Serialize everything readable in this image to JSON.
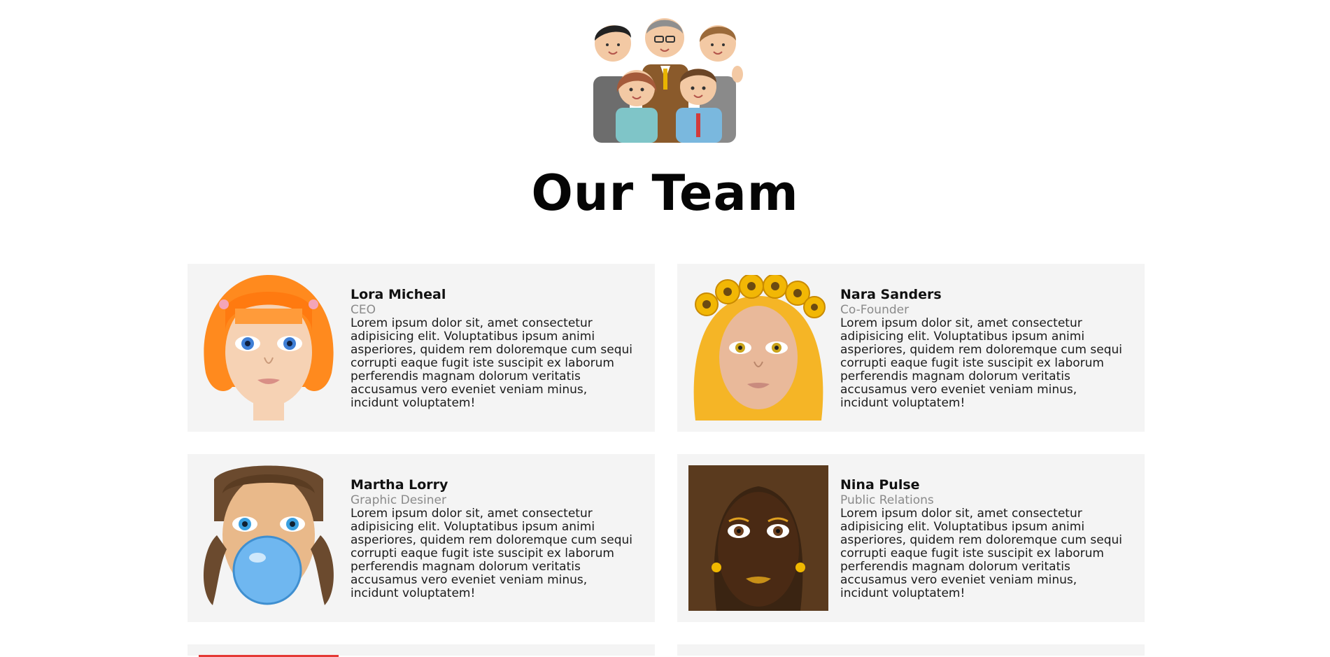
{
  "header": {
    "title": "Our Team"
  },
  "team": [
    {
      "name": "Lora Micheal",
      "role": "CEO",
      "bio": "Lorem ipsum dolor sit, amet consectetur adipisicing elit. Voluptatibus ipsum animi asperiores, quidem rem doloremque cum sequi corrupti eaque fugit iste suscipit ex laborum perferendis magnam dolorum veritatis accusamus vero eveniet veniam minus, incidunt voluptatem!"
    },
    {
      "name": "Nara Sanders",
      "role": "Co-Founder",
      "bio": "Lorem ipsum dolor sit, amet consectetur adipisicing elit. Voluptatibus ipsum animi asperiores, quidem rem doloremque cum sequi corrupti eaque fugit iste suscipit ex laborum perferendis magnam dolorum veritatis accusamus vero eveniet veniam minus, incidunt voluptatem!"
    },
    {
      "name": "Martha Lorry",
      "role": "Graphic Desiner",
      "bio": "Lorem ipsum dolor sit, amet consectetur adipisicing elit. Voluptatibus ipsum animi asperiores, quidem rem doloremque cum sequi corrupti eaque fugit iste suscipit ex laborum perferendis magnam dolorum veritatis accusamus vero eveniet veniam minus, incidunt voluptatem!"
    },
    {
      "name": "Nina Pulse",
      "role": "Public Relations",
      "bio": "Lorem ipsum dolor sit, amet consectetur adipisicing elit. Voluptatibus ipsum animi asperiores, quidem rem doloremque cum sequi corrupti eaque fugit iste suscipit ex laborum perferendis magnam dolorum veritatis accusamus vero eveniet veniam minus, incidunt voluptatem!"
    }
  ],
  "colors": {
    "card_background": "#f4f4f4",
    "role_text": "#8a8a8a",
    "accent_red": "#e53935"
  }
}
